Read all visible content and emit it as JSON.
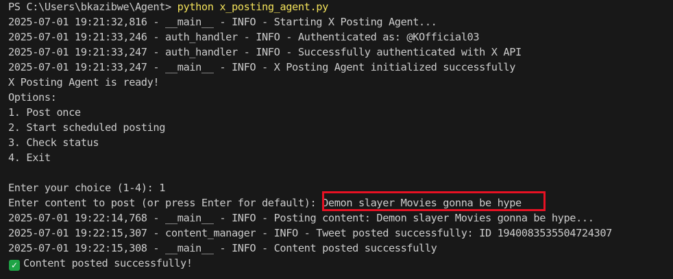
{
  "terminal": {
    "prompt": "PS C:\\Users\\bkazibwe\\Agent>",
    "command": "python x_posting_agent.py",
    "lines": [
      "2025-07-01 19:21:32,816 - __main__ - INFO - Starting X Posting Agent...",
      "2025-07-01 19:21:33,246 - auth_handler - INFO - Authenticated as: @KOfficial03",
      "2025-07-01 19:21:33,247 - auth_handler - INFO - Successfully authenticated with X API",
      "2025-07-01 19:21:33,247 - __main__ - INFO - X Posting Agent initialized successfully",
      "X Posting Agent is ready!",
      "Options:",
      "1. Post once",
      "2. Start scheduled posting",
      "3. Check status",
      "4. Exit",
      "",
      "Enter your choice (1-4): 1"
    ],
    "content_prompt": "Enter content to post (or press Enter for default):",
    "content_input": "Demon slayer Movies gonna be hype",
    "after_lines": [
      "2025-07-01 19:22:14,768 - __main__ - INFO - Posting content: Demon slayer Movies gonna be hype...",
      "2025-07-01 19:22:15,307 - content_manager - INFO - Tweet posted successfully: ID 1940083535504724307",
      "2025-07-01 19:22:15,308 - __main__ - INFO - Content posted successfully"
    ],
    "success_icon": "check-mark-icon",
    "success_text": "Content posted successfully!",
    "colors": {
      "background": "#181818",
      "text": "#cccccc",
      "command": "#f1e05a",
      "highlight": "#e81123",
      "check": "#1ea446"
    }
  }
}
